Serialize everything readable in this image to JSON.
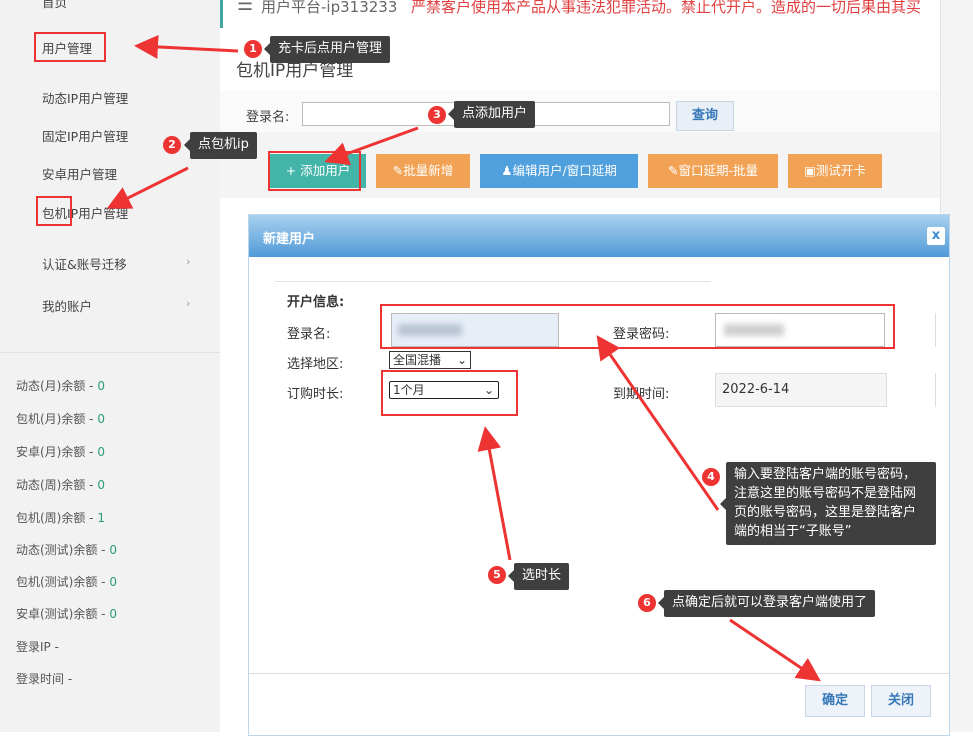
{
  "topbar": {
    "menu_icon": "menu-icon",
    "title": "用户平台-ip313233",
    "warning": "严禁客户使用本产品从事违法犯罪活动。禁止代开户。造成的一切后果由其买"
  },
  "sidebar": {
    "cut_item": "首页",
    "items": [
      {
        "label": "用户管理"
      },
      {
        "label": "动态IP用户管理"
      },
      {
        "label": "固定IP用户管理"
      },
      {
        "label": "安卓用户管理"
      },
      {
        "label": "包机IP用户管理"
      },
      {
        "label": "认证&账号迁移"
      },
      {
        "label": "我的账户"
      }
    ],
    "balances": [
      {
        "label": "动态(月)余额 - ",
        "value": "0"
      },
      {
        "label": "包机(月)余额 - ",
        "value": "0"
      },
      {
        "label": "安卓(月)余额 - ",
        "value": "0"
      },
      {
        "label": "动态(周)余额 - ",
        "value": "0"
      },
      {
        "label": "包机(周)余额 - ",
        "value": "1"
      },
      {
        "label": "动态(测试)余额 - ",
        "value": "0"
      },
      {
        "label": "包机(测试)余额 - ",
        "value": "0"
      },
      {
        "label": "安卓(测试)余额 - ",
        "value": "0"
      }
    ],
    "login_ip": "登录IP -",
    "login_time": "登录时间 -"
  },
  "page": {
    "title": "包机IP用户管理",
    "login_label": "登录名:",
    "search_button": "查询",
    "buttons": {
      "add": "+ 添加用户",
      "batch_add": "批量新增",
      "edit": "编辑用户/窗口延期",
      "extend_batch": "窗口延期-批量",
      "test_card": "测试开卡"
    },
    "colors": {
      "teal": "#43b4a8",
      "orange": "#f1a255",
      "blue": "#4fa0dc"
    }
  },
  "modal": {
    "title": "新建用户",
    "close_glyph": "x",
    "section": "开户信息:",
    "login_label": "登录名:",
    "password_label": "登录密码:",
    "region_label": "选择地区:",
    "region_value": "全国混播",
    "duration_label": "订购时长:",
    "duration_value": "1个月",
    "expire_label": "到期时间:",
    "expire_value": "2022-6-14",
    "ok": "确定",
    "close": "关闭"
  },
  "annotations": [
    {
      "num": "1",
      "text": "充卡后点用户管理"
    },
    {
      "num": "2",
      "text": "点包机ip"
    },
    {
      "num": "3",
      "text": "点添加用户"
    },
    {
      "num": "4",
      "text": "输入要登陆客户端的账号密码，注意这里的账号密码不是登陆网页的账号密码，这里是登陆客户端的相当于“子账号”"
    },
    {
      "num": "5",
      "text": "选时长"
    },
    {
      "num": "6",
      "text": "点确定后就可以登录客户端使用了"
    }
  ]
}
